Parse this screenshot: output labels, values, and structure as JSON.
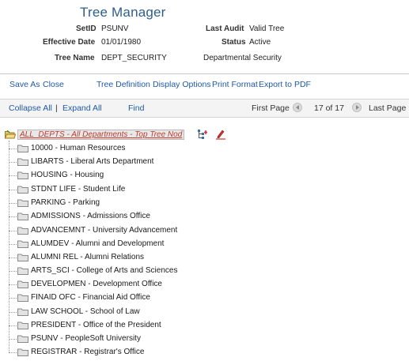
{
  "page": {
    "title": "Tree Manager"
  },
  "header": {
    "setid_label": "SetID",
    "setid": "PSUNV",
    "last_audit_label": "Last Audit",
    "last_audit": "Valid Tree",
    "effective_date_label": "Effective Date",
    "effective_date": "01/01/1980",
    "status_label": "Status",
    "status": "Active",
    "tree_name_label": "Tree Name",
    "tree_name": "DEPT_SECURITY",
    "tree_description": "Departmental Security"
  },
  "toolbar": {
    "save_as": "Save As",
    "close": "Close",
    "tree_definition": "Tree Definition",
    "display_options": "Display Options",
    "print_format": "Print Format",
    "export_pdf": "Export to PDF"
  },
  "navbar": {
    "collapse_all": "Collapse All",
    "divider": "|",
    "expand_all": "Expand All",
    "find": "Find",
    "first_page": "First Page",
    "page_info": "17 of 17",
    "last_page": "Last Page"
  },
  "tree": {
    "root": "ALL_DEPTS - All Departments - Top Tree Nod",
    "nodes": [
      "10000 - Human Resources",
      "LIBARTS - Liberal Arts Department",
      "HOUSING - Housing",
      "STDNT LIFE - Student Life",
      "PARKING - Parking",
      "ADMISSIONS - Admissions Office",
      "ADVANCEMNT - University Advancement",
      "ALUMDEV - Alumni and Development",
      "ALUMNI REL - Alumni Relations",
      "ARTS_SCI - College of Arts and Sciences",
      "DEVELOPMEN - Development Office",
      "FINAID OFC - Financial Aid Office",
      "LAW SCHOOL - School of Law",
      "PRESIDENT - Office of the President",
      "PSUNV - PeopleSoft University",
      "REGISTRAR - Registrar's Office"
    ]
  },
  "icons": {
    "folder": "folder-icon",
    "root_folder": "open-folder-icon",
    "insert_child": "insert-child-icon",
    "edit": "edit-data-icon",
    "prev": "previous-page-icon",
    "next": "next-page-icon"
  },
  "colors": {
    "link": "#1f5aa6",
    "title": "#2d5f8a",
    "root_text": "#c0392b"
  }
}
